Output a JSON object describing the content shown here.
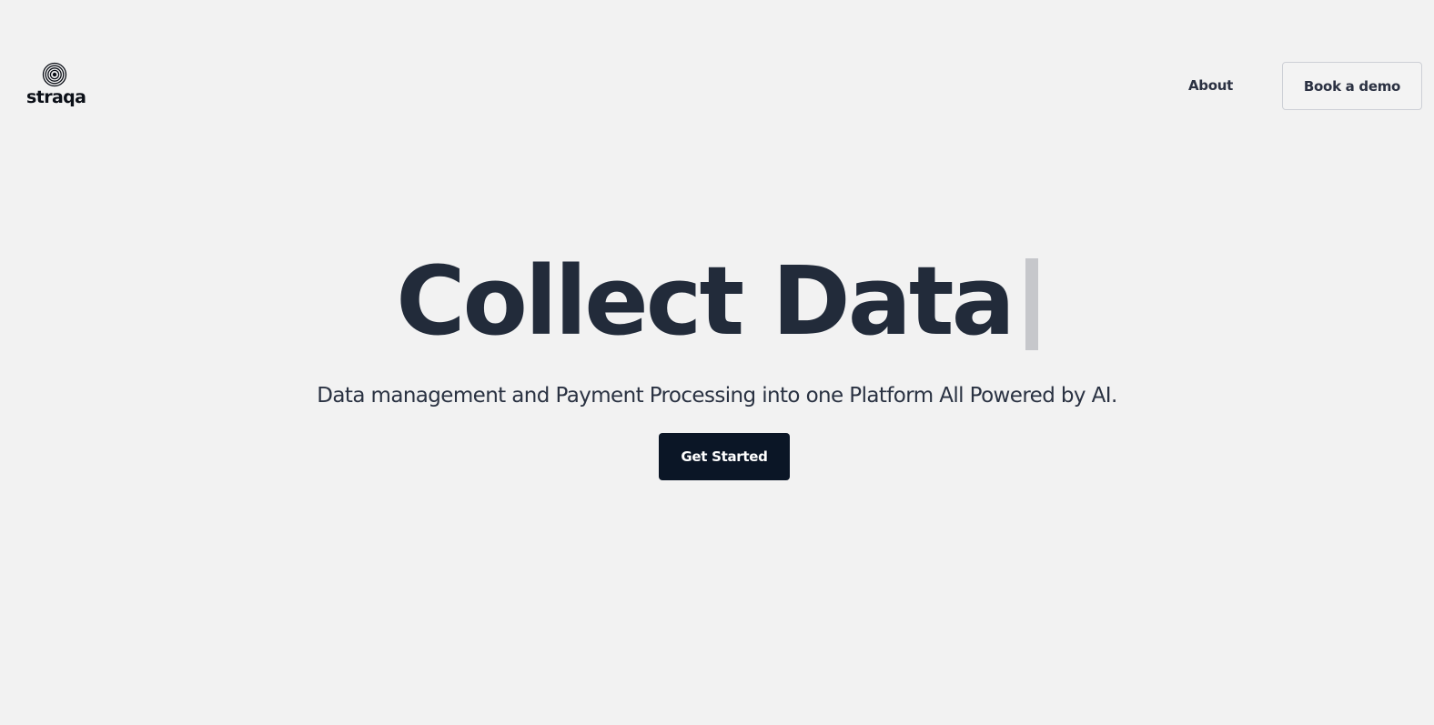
{
  "header": {
    "logo_text": "straqa",
    "logo_icon": "fingerprint-spiral-icon",
    "nav_about_label": "About",
    "book_demo_label": "Book a demo"
  },
  "hero": {
    "title": "Collect Data",
    "subtitle": "Data management and Payment Processing into one Platform All Powered by AI.",
    "cta_label": "Get Started"
  },
  "colors": {
    "background": "#f2f2f2",
    "heading": "#222b3a",
    "cta_background": "#0b1626",
    "cursor": "#c6c7cb"
  }
}
